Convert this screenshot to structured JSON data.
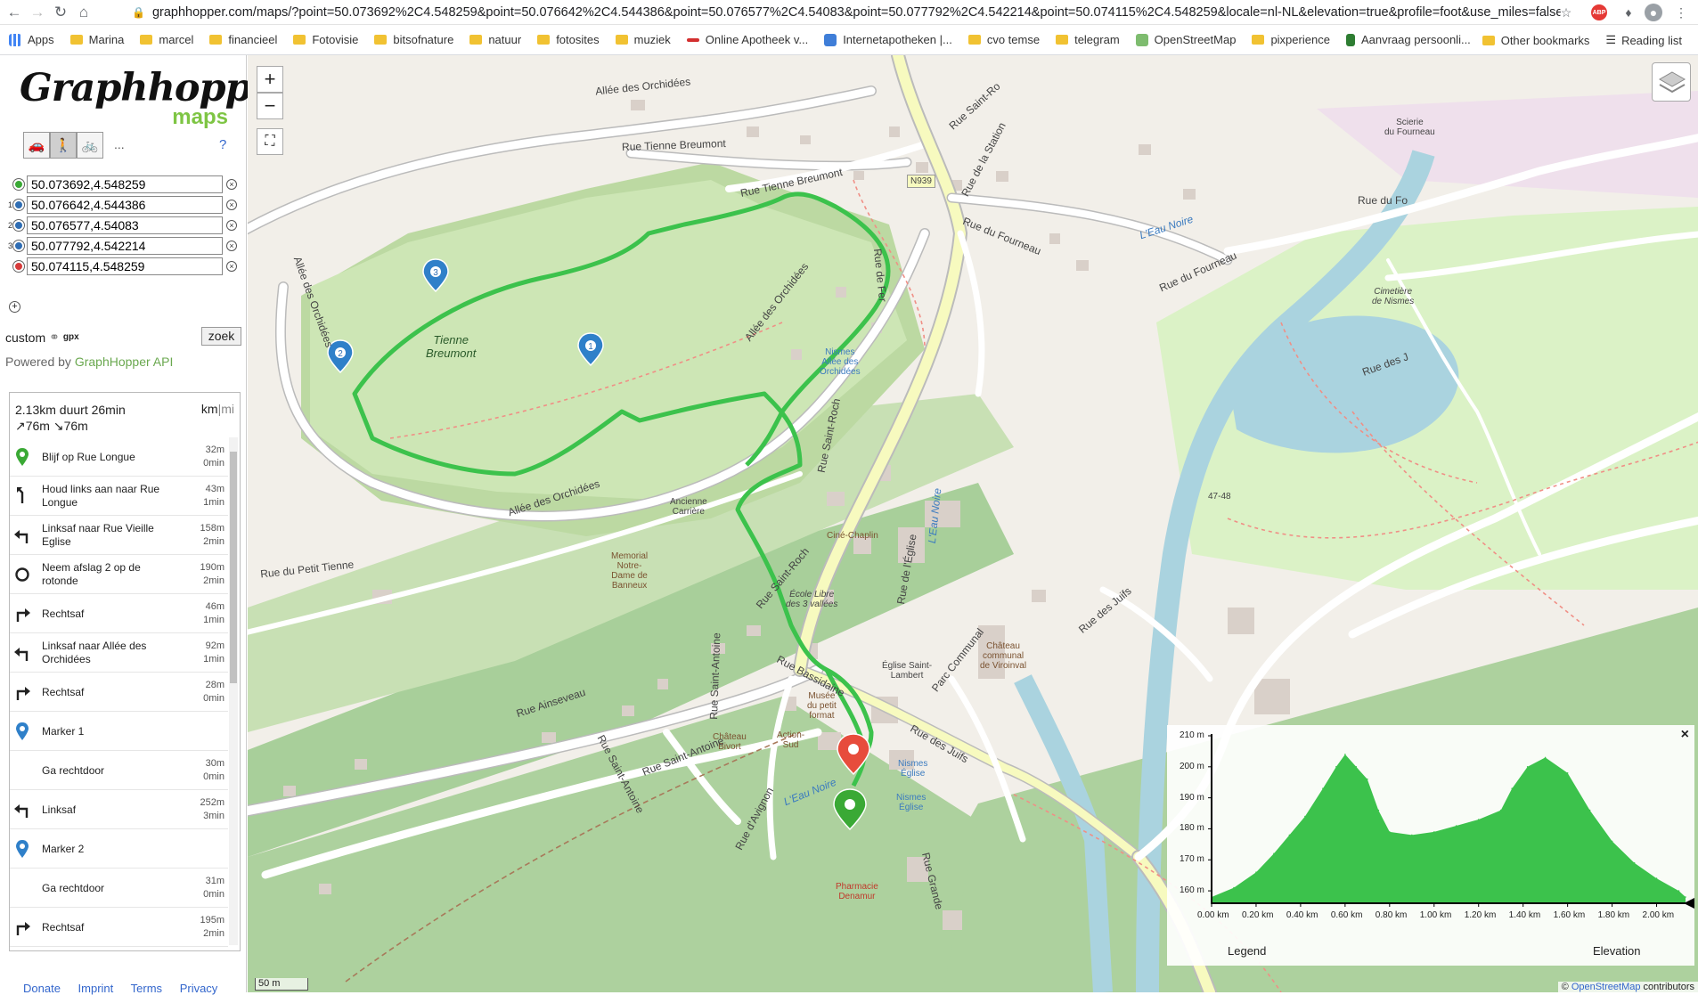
{
  "browser": {
    "url": "graphhopper.com/maps/?point=50.073692%2C4.548259&point=50.076642%2C4.544386&point=50.076577%2C4.54083&point=50.077792%2C4.542214&point=50.074115%2C4.548259&locale=nl-NL&elevation=true&profile=foot&use_miles=false&se...",
    "extensions": [
      "ABP",
      "puzzle-icon",
      "avatar"
    ],
    "bookmarks": [
      "Apps",
      "Marina",
      "marcel",
      "financieel",
      "Fotovisie",
      "bitsofnature",
      "natuur",
      "fotosites",
      "muziek",
      "Online Apotheek v...",
      "Internetapotheken |...",
      "cvo temse",
      "telegram",
      "OpenStreetMap",
      "pixperience",
      "Aanvraag persoonli..."
    ],
    "bookmarks_more": "»",
    "other_bookmarks": "Other bookmarks",
    "reading_list": "Reading list"
  },
  "sidebar": {
    "logo_word": "Graphhopper",
    "logo_sub": "maps",
    "vehicles_more": "...",
    "help": "?",
    "points": [
      {
        "num": "",
        "value": "50.073692,4.548259",
        "color": "#3aa935"
      },
      {
        "num": "1",
        "value": "50.076642,4.544386",
        "color": "#2f6db3"
      },
      {
        "num": "2",
        "value": "50.076577,4.54083",
        "color": "#2f6db3"
      },
      {
        "num": "3",
        "value": "50.077792,4.542214",
        "color": "#2f6db3"
      },
      {
        "num": "",
        "value": "50.074115,4.548259",
        "color": "#d63b3b"
      }
    ],
    "custom_label": "custom",
    "gpx_label": "gpx",
    "search_button": "zoek",
    "powered_prefix": "Powered by ",
    "powered_link": "GraphHopper API",
    "summary_line1": "2.13km duurt 26min",
    "summary_line2": "↗76m ↘76m",
    "units_km": "km",
    "units_sep": "|",
    "units_mi": "mi",
    "steps": [
      {
        "icon": "marker-green",
        "text": "Blijf op Rue Longue",
        "dist": "32m",
        "time": "0min"
      },
      {
        "icon": "keep-left",
        "text": "Houd links aan naar Rue Longue",
        "dist": "43m",
        "time": "1min"
      },
      {
        "icon": "turn-left",
        "text": "Linksaf naar Rue Vieille Eglise",
        "dist": "158m",
        "time": "2min"
      },
      {
        "icon": "roundabout",
        "text": "Neem afslag 2 op de rotonde",
        "dist": "190m",
        "time": "2min"
      },
      {
        "icon": "turn-right",
        "text": "Rechtsaf",
        "dist": "46m",
        "time": "1min"
      },
      {
        "icon": "turn-left",
        "text": "Linksaf naar Allée des Orchidées",
        "dist": "92m",
        "time": "1min"
      },
      {
        "icon": "turn-right",
        "text": "Rechtsaf",
        "dist": "28m",
        "time": "0min"
      },
      {
        "icon": "marker-blue",
        "text": "Marker 1",
        "dist": "",
        "time": ""
      },
      {
        "icon": "none",
        "text": "Ga rechtdoor",
        "dist": "30m",
        "time": "0min"
      },
      {
        "icon": "turn-left",
        "text": "Linksaf",
        "dist": "252m",
        "time": "3min"
      },
      {
        "icon": "marker-blue",
        "text": "Marker 2",
        "dist": "",
        "time": ""
      },
      {
        "icon": "none",
        "text": "Ga rechtdoor",
        "dist": "31m",
        "time": "0min"
      },
      {
        "icon": "turn-right",
        "text": "Rechtsaf",
        "dist": "195m",
        "time": "2min"
      }
    ],
    "footer": [
      "Donate",
      "Imprint",
      "Terms",
      "Privacy"
    ]
  },
  "map": {
    "zoom_in": "+",
    "zoom_out": "−",
    "fullscreen": "⛶",
    "scale": "50 m",
    "attribution_prefix": "© ",
    "attribution_link": "OpenStreetMap",
    "attribution_suffix": " contributors",
    "labels": {
      "allee_top": "Allée des Orchidées",
      "tienne_breumont": "Rue Tienne Breumont",
      "tienne_breumont2": "Rue Tienne Breumont",
      "park_name": "Tienne\nBreumont",
      "allee_left": "Allée des Orchidées",
      "allee_mid": "Allée des Orchidées",
      "allee_bottom": "Allée des Orchidées",
      "petit_tienne": "Rue du Petit Tienne",
      "carriere": "Ancienne\nCarrière",
      "memorial": "Memorial\nNotre-\nDame de\nBanneux",
      "saint_roch": "Rue Saint-Roch",
      "saint_roch2": "Rue Saint-Roch",
      "nismes_allee": "Nismes\nAllée des\nOrchidées",
      "cine": "Ciné-Chaplin",
      "ecole": "École Libre\ndes 3 vallées",
      "eglise": "Église Saint-\nLambert",
      "rue_eglise": "Rue de l'Église",
      "bassidaine": "Rue Bassidaine",
      "musee": "Musée\ndu petit\nformat",
      "chateau_bivort": "Château\nBivort",
      "ainseveau": "Rue Ainseveau",
      "saint_antoine": "Rue Saint-Antoine",
      "saint_antoine2": "Rue Saint-Antoine",
      "saint_antoine3": "Rue Saint-Antoine",
      "avignon": "Rue d'Avignon",
      "eau_noire": "L'Eau Noire",
      "eau_noire2": "L'Eau Noire",
      "eau_noire3": "L'Eau Noire",
      "pharmacie": "Pharmacie\nDenamur",
      "nismes_eglise": "Nismes\nÉglise",
      "nismes_eglise2": "Nismes\nÉglise",
      "rue_grande": "Rue Grande",
      "rue_juifs": "Rue des Juifs",
      "rue_juifs2": "Rue des Juifs",
      "parc_communal": "Parc Communal",
      "chateau_viroinval": "Château\ncommunal\nde Viroinval",
      "fourneau": "Rue du Fourneau",
      "fourneau2": "Rue du Fourneau",
      "fourneau3": "Rue du Fo",
      "station": "Rue de la Station",
      "saint_ro_top": "Rue Saint-Ro",
      "rue_fer": "Rue de Fer",
      "n939": "N939",
      "scierie": "Scierie\ndu Fourneau",
      "cimetiere": "Cimetière\nde Nismes",
      "rue_des": "Rue des J",
      "action": "Action-\nSud",
      "elev_4748": "47-48"
    }
  },
  "elevation": {
    "close": "×",
    "legend": "Legend",
    "title": "Elevation",
    "y_ticks": [
      "210 m",
      "200 m",
      "190 m",
      "180 m",
      "170 m",
      "160 m"
    ],
    "x_ticks": [
      "0.00 km",
      "0.20 km",
      "0.40 km",
      "0.60 km",
      "0.80 km",
      "1.00 km",
      "1.20 km",
      "1.40 km",
      "1.60 km",
      "1.80 km",
      "2.00 km"
    ]
  },
  "chart_data": {
    "type": "area",
    "xlabel": "",
    "ylabel": "",
    "x": [
      0,
      0.1,
      0.2,
      0.28,
      0.35,
      0.42,
      0.5,
      0.56,
      0.6,
      0.65,
      0.7,
      0.75,
      0.8,
      0.9,
      1.0,
      1.1,
      1.2,
      1.3,
      1.35,
      1.42,
      1.5,
      1.6,
      1.7,
      1.8,
      1.9,
      2.0,
      2.1,
      2.13
    ],
    "values": [
      158,
      161,
      166,
      172,
      178,
      184,
      193,
      200,
      204,
      200,
      196,
      186,
      179,
      178,
      179,
      181,
      183,
      186,
      193,
      200,
      203,
      198,
      186,
      176,
      169,
      164,
      160,
      158
    ],
    "xlim": [
      0,
      2.13
    ],
    "ylim": [
      156,
      210
    ],
    "color": "#3cc24c"
  }
}
